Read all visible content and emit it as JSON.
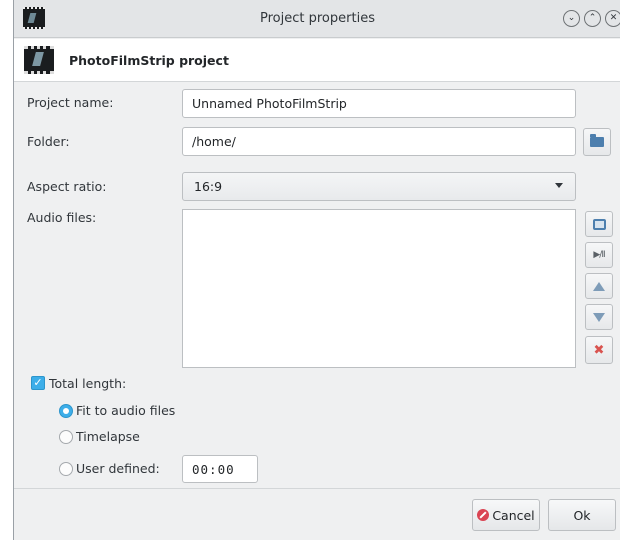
{
  "window": {
    "title": "Project properties",
    "buttons": {
      "minimize_icon": "chevron-down-icon",
      "maximize_icon": "chevron-up-icon",
      "close_icon": "close-icon"
    }
  },
  "header": {
    "title": "PhotoFilmStrip project"
  },
  "form": {
    "project_name_label": "Project name:",
    "project_name_value": "Unnamed PhotoFilmStrip",
    "folder_label": "Folder:",
    "folder_value": "/home/",
    "aspect_ratio_label": "Aspect ratio:",
    "aspect_ratio_value": "16:9",
    "audio_files_label": "Audio files:",
    "audio_files": [],
    "audio_buttons": [
      "open-icon",
      "play-pause-icon",
      "move-up-icon",
      "move-down-icon",
      "remove-icon"
    ],
    "play_pause_glyph": "▶/II",
    "remove_glyph": "✖",
    "total_length_label": "Total length:",
    "total_length_checked": true,
    "options": {
      "fit_to_audio": "Fit to audio files",
      "timelapse": "Timelapse",
      "user_defined": "User defined:"
    },
    "selected_option": "fit_to_audio",
    "user_defined_value": "00:00"
  },
  "footer": {
    "cancel_label": "Cancel",
    "ok_label": "Ok"
  },
  "colors": {
    "accent": "#3daee9",
    "cancel_red": "#da4453",
    "window_bg": "#eff0f1"
  }
}
